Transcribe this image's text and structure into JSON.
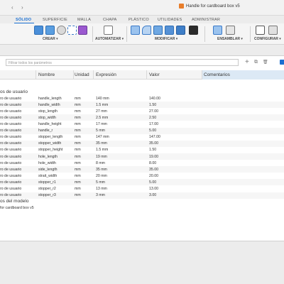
{
  "window": {
    "back_glyph": "‹",
    "forward_glyph": "›",
    "document_title": "Handle for cardboard box v5"
  },
  "ribbon": {
    "tabs": [
      "SÓLIDO",
      "SUPERFICIE",
      "MALLA",
      "CHAPA",
      "PLÁSTICO",
      "UTILIDADES",
      "ADMINISTRAR"
    ],
    "groups": [
      "CREAR ▾",
      "AUTOMATIZAR ▾",
      "MODIFICAR ▾",
      "ENSAMBLAR ▾",
      "CONFIGURAR ▾"
    ],
    "accent_color": "#1a6fd1"
  },
  "panel": {
    "filter_placeholder": "Filtrar todos los parámetros",
    "add_glyph": "+",
    "copy_glyph": "⧉",
    "delete_glyph": "🗑",
    "columns": [
      "Nombre",
      "Unidad",
      "Expresión",
      "Valor",
      "Comentarios"
    ],
    "section_user": "os de usuario",
    "section_model": "os del modelo",
    "user_params": [
      {
        "type": "ro de usuario",
        "name": "handle_length",
        "unit": "mm",
        "expr": "140 mm",
        "value": "140.00"
      },
      {
        "type": "ro de usuario",
        "name": "handle_width",
        "unit": "mm",
        "expr": "1.5 mm",
        "value": "1.50"
      },
      {
        "type": "ro de usuario",
        "name": "stop_length",
        "unit": "mm",
        "expr": "27 mm",
        "value": "27.00"
      },
      {
        "type": "ro de usuario",
        "name": "stop_width",
        "unit": "mm",
        "expr": "2.5 mm",
        "value": "2.50"
      },
      {
        "type": "ro de usuario",
        "name": "handle_height",
        "unit": "mm",
        "expr": "17 mm",
        "value": "17.00"
      },
      {
        "type": "ro de usuario",
        "name": "handle_r",
        "unit": "mm",
        "expr": "5 mm",
        "value": "5.00"
      },
      {
        "type": "ro de usuario",
        "name": "stopper_length",
        "unit": "mm",
        "expr": "147 mm",
        "value": "147.00"
      },
      {
        "type": "ro de usuario",
        "name": "stopper_width",
        "unit": "mm",
        "expr": "35 mm",
        "value": "35.00"
      },
      {
        "type": "ro de usuario",
        "name": "stopper_height",
        "unit": "mm",
        "expr": "1.5 mm",
        "value": "1.50"
      },
      {
        "type": "ro de usuario",
        "name": "hole_length",
        "unit": "mm",
        "expr": "19 mm",
        "value": "19.00"
      },
      {
        "type": "ro de usuario",
        "name": "hole_width",
        "unit": "mm",
        "expr": "8 mm",
        "value": "8.00"
      },
      {
        "type": "ro de usuario",
        "name": "side_length",
        "unit": "mm",
        "expr": "35 mm",
        "value": "35.00"
      },
      {
        "type": "ro de usuario",
        "name": "strait_width",
        "unit": "mm",
        "expr": "20 mm",
        "value": "20.00"
      },
      {
        "type": "ro de usuario",
        "name": "stopper_r1",
        "unit": "mm",
        "expr": "5 mm",
        "value": "5.00"
      },
      {
        "type": "ro de usuario",
        "name": "stopper_r2",
        "unit": "mm",
        "expr": "13 mm",
        "value": "13.00"
      },
      {
        "type": "ro de usuario",
        "name": "stopper_r3",
        "unit": "mm",
        "expr": "3 mm",
        "value": "3.00"
      }
    ],
    "model_item": "for cardboard box v5"
  }
}
